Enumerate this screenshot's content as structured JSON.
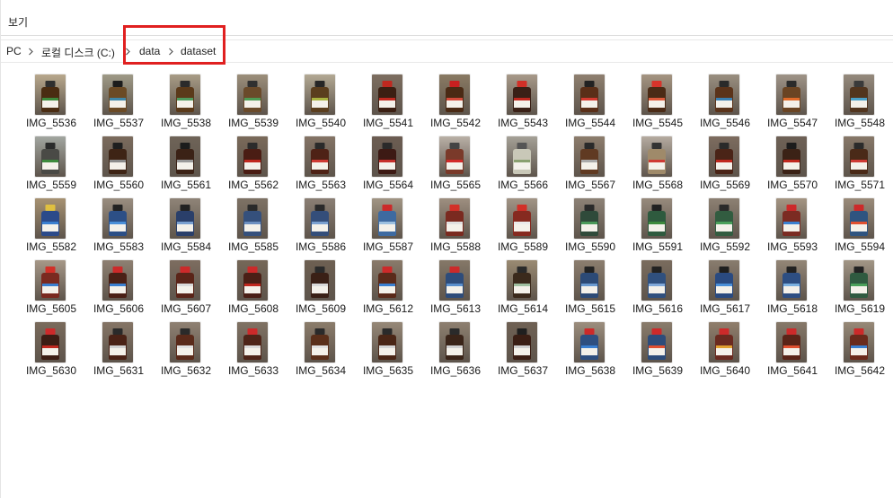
{
  "menu": {
    "view_label": "보기"
  },
  "breadcrumb": {
    "pc": "PC",
    "drive": "로컬 디스크 (C:)",
    "folder1": "data",
    "folder2": "dataset"
  },
  "files": [
    {
      "name": "IMG_5536",
      "bg": "#b8a88d",
      "bottle": "#4a2c12",
      "cap": "#2f2f2f",
      "mark": "#3d8a3d"
    },
    {
      "name": "IMG_5537",
      "bg": "#9f9a87",
      "bottle": "#6b4a25",
      "cap": "#1c1c1c",
      "mark": "#3f86a8"
    },
    {
      "name": "IMG_5538",
      "bg": "#a89c86",
      "bottle": "#5b3a1a",
      "cap": "#2b2b2b",
      "mark": "#4f9a5d"
    },
    {
      "name": "IMG_5539",
      "bg": "#9c8f7b",
      "bottle": "#6a4a2a",
      "cap": "#303030",
      "mark": "#4d9b55"
    },
    {
      "name": "IMG_5540",
      "bg": "#b3a994",
      "bottle": "#5b3e1e",
      "cap": "#262626",
      "mark": "#a8b240"
    },
    {
      "name": "IMG_5541",
      "bg": "#7d6e60",
      "bottle": "#3b1f12",
      "cap": "#c0281f",
      "mark": "#c0281f"
    },
    {
      "name": "IMG_5542",
      "bg": "#8a7a63",
      "bottle": "#4a2a14",
      "cap": "#c82020",
      "mark": "#d24a3a"
    },
    {
      "name": "IMG_5543",
      "bg": "#a89a8a",
      "bottle": "#3a2016",
      "cap": "#d23028",
      "mark": "#c0281f"
    },
    {
      "name": "IMG_5544",
      "bg": "#8f8070",
      "bottle": "#5a2f18",
      "cap": "#222",
      "mark": "#d43a30"
    },
    {
      "name": "IMG_5545",
      "bg": "#a59582",
      "bottle": "#4b2b16",
      "cap": "#d7342b",
      "mark": "#dd5a3b"
    },
    {
      "name": "IMG_5546",
      "bg": "#9a8f80",
      "bottle": "#5b331a",
      "cap": "#2a2a2a",
      "mark": "#3a7fb0"
    },
    {
      "name": "IMG_5547",
      "bg": "#9f9488",
      "bottle": "#6a4423",
      "cap": "#2b2b2b",
      "mark": "#e06a2a"
    },
    {
      "name": "IMG_5548",
      "bg": "#958a7d",
      "bottle": "#52351e",
      "cap": "#3a3a3a",
      "mark": "#4aa0c8"
    },
    {
      "name": "IMG_5559",
      "bg": "#a2a6a0",
      "bottle": "#4a4a46",
      "cap": "#2b2b2b",
      "mark": "#3d8a3d"
    },
    {
      "name": "IMG_5560",
      "bg": "#7b6b5d",
      "bottle": "#3e2415",
      "cap": "#1f1f1f",
      "mark": "#8b8b8b"
    },
    {
      "name": "IMG_5561",
      "bg": "#6f6458",
      "bottle": "#3b2216",
      "cap": "#1c1c1c",
      "mark": "#999"
    },
    {
      "name": "IMG_5562",
      "bg": "#7a6a5a",
      "bottle": "#4a1d14",
      "cap": "#2b2b2b",
      "mark": "#c0281f"
    },
    {
      "name": "IMG_5563",
      "bg": "#847466",
      "bottle": "#4e2216",
      "cap": "#2a2a2a",
      "mark": "#cf3a34"
    },
    {
      "name": "IMG_5564",
      "bg": "#6c5d52",
      "bottle": "#3d1a14",
      "cap": "#2a2a2a",
      "mark": "#c62f2a"
    },
    {
      "name": "IMG_5565",
      "bg": "#b9b0a6",
      "bottle": "#7a3a2a",
      "cap": "#444",
      "mark": "#d22a2a"
    },
    {
      "name": "IMG_5566",
      "bg": "#a5a197",
      "bottle": "#c9c8b8",
      "cap": "#555",
      "mark": "#8aa070"
    },
    {
      "name": "IMG_5567",
      "bg": "#8d7d6d",
      "bottle": "#603a22",
      "cap": "#2a2a2a",
      "mark": "#aaa"
    },
    {
      "name": "IMG_5568",
      "bg": "#b5aba0",
      "bottle": "#9f8a6a",
      "cap": "#333",
      "mark": "#cf3a34"
    },
    {
      "name": "IMG_5569",
      "bg": "#7d6c5f",
      "bottle": "#4a2417",
      "cap": "#2a2a2a",
      "mark": "#c0281f"
    },
    {
      "name": "IMG_5570",
      "bg": "#6e6156",
      "bottle": "#3b2216",
      "cap": "#1c1c1c",
      "mark": "#c0281f"
    },
    {
      "name": "IMG_5571",
      "bg": "#877869",
      "bottle": "#4a2a18",
      "cap": "#2b2b2b",
      "mark": "#cf3a34"
    },
    {
      "name": "IMG_5582",
      "bg": "#a79272",
      "bottle": "#2b4a8a",
      "cap": "#e0c040",
      "mark": "#3a7fd0"
    },
    {
      "name": "IMG_5583",
      "bg": "#9a8e80",
      "bottle": "#2c4f86",
      "cap": "#222",
      "mark": "#4a8fd8"
    },
    {
      "name": "IMG_5584",
      "bg": "#8f8478",
      "bottle": "#2a3f6a",
      "cap": "#222",
      "mark": "#7aa0d0"
    },
    {
      "name": "IMG_5585",
      "bg": "#7e7265",
      "bottle": "#35507c",
      "cap": "#2a2a2a",
      "mark": "#6c8fc0"
    },
    {
      "name": "IMG_5586",
      "bg": "#8b7f74",
      "bottle": "#344e7a",
      "cap": "#2a2a2a",
      "mark": "#7aa0d0"
    },
    {
      "name": "IMG_5587",
      "bg": "#a19584",
      "bottle": "#3e6aa0",
      "cap": "#cc2a2a",
      "mark": "#9cc0e0"
    },
    {
      "name": "IMG_5588",
      "bg": "#9e8f80",
      "bottle": "#7a2a20",
      "cap": "#d23028",
      "mark": "#e0e0e0"
    },
    {
      "name": "IMG_5589",
      "bg": "#a29586",
      "bottle": "#862a20",
      "cap": "#d23028",
      "mark": "#eaeaea"
    },
    {
      "name": "IMG_5590",
      "bg": "#8d8276",
      "bottle": "#2f4a3a",
      "cap": "#2a2a2a",
      "mark": "#4a9a5a"
    },
    {
      "name": "IMG_5591",
      "bg": "#978a7c",
      "bottle": "#2e5a3e",
      "cap": "#222",
      "mark": "#3d8a3d"
    },
    {
      "name": "IMG_5592",
      "bg": "#8d8173",
      "bottle": "#325c40",
      "cap": "#2a2a2a",
      "mark": "#4aa05a"
    },
    {
      "name": "IMG_5593",
      "bg": "#a49583",
      "bottle": "#7b2b22",
      "cap": "#cc2a2a",
      "mark": "#3a7fd0"
    },
    {
      "name": "IMG_5594",
      "bg": "#9a8b7a",
      "bottle": "#2f5480",
      "cap": "#cc2a2a",
      "mark": "#e05030"
    },
    {
      "name": "IMG_5605",
      "bg": "#a69888",
      "bottle": "#7a2a20",
      "cap": "#d23028",
      "mark": "#3a7fd0"
    },
    {
      "name": "IMG_5606",
      "bg": "#8e8072",
      "bottle": "#4a2016",
      "cap": "#cc2a2a",
      "mark": "#3a7fd0"
    },
    {
      "name": "IMG_5607",
      "bg": "#7d6d60",
      "bottle": "#5a2418",
      "cap": "#cc2a2a",
      "mark": "#d9d9d9"
    },
    {
      "name": "IMG_5608",
      "bg": "#756758",
      "bottle": "#4a1f16",
      "cap": "#cc2a2a",
      "mark": "#c0281f"
    },
    {
      "name": "IMG_5609",
      "bg": "#6e6052",
      "bottle": "#3a2016",
      "cap": "#2a2a2a",
      "mark": "#d9d9d9"
    },
    {
      "name": "IMG_5612",
      "bg": "#8a7a6a",
      "bottle": "#5a2a1a",
      "cap": "#cc2a2a",
      "mark": "#3a7fd0"
    },
    {
      "name": "IMG_5613",
      "bg": "#857868",
      "bottle": "#2e4c7a",
      "cap": "#cc2a2a",
      "mark": "#5a8fcc"
    },
    {
      "name": "IMG_5614",
      "bg": "#9a8a72",
      "bottle": "#3b2a1c",
      "cap": "#2a2a2a",
      "mark": "#a0c0a0"
    },
    {
      "name": "IMG_5615",
      "bg": "#8c7e6f",
      "bottle": "#2c4a76",
      "cap": "#222",
      "mark": "#6a9ad0"
    },
    {
      "name": "IMG_5616",
      "bg": "#7a6c5e",
      "bottle": "#30507e",
      "cap": "#222",
      "mark": "#80a8d8"
    },
    {
      "name": "IMG_5617",
      "bg": "#897c6e",
      "bottle": "#2a4a80",
      "cap": "#1f1f1f",
      "mark": "#4a8fd8"
    },
    {
      "name": "IMG_5618",
      "bg": "#938677",
      "bottle": "#2d4e82",
      "cap": "#222",
      "mark": "#7ab0e0"
    },
    {
      "name": "IMG_5619",
      "bg": "#a29686",
      "bottle": "#2f5a40",
      "cap": "#222",
      "mark": "#4aa05a"
    },
    {
      "name": "IMG_5630",
      "bg": "#7a6b5c",
      "bottle": "#3c1d14",
      "cap": "#cc2a2a",
      "mark": "#c0281f"
    },
    {
      "name": "IMG_5631",
      "bg": "#857566",
      "bottle": "#4a2216",
      "cap": "#2a2a2a",
      "mark": "#d0d0d0"
    },
    {
      "name": "IMG_5632",
      "bg": "#8f8172",
      "bottle": "#5a2a1a",
      "cap": "#2a2a2a",
      "mark": "#e0e0e0"
    },
    {
      "name": "IMG_5633",
      "bg": "#807264",
      "bottle": "#4e2418",
      "cap": "#cc2a2a",
      "mark": "#d9d9d9"
    },
    {
      "name": "IMG_5634",
      "bg": "#8b7c6b",
      "bottle": "#5a2f1a",
      "cap": "#2a2a2a",
      "mark": "#e0e0e0"
    },
    {
      "name": "IMG_5635",
      "bg": "#968878",
      "bottle": "#4a2616",
      "cap": "#2a2a2a",
      "mark": "#d4d4d4"
    },
    {
      "name": "IMG_5636",
      "bg": "#8e8070",
      "bottle": "#3a2418",
      "cap": "#2a2a2a",
      "mark": "#cfcfcf"
    },
    {
      "name": "IMG_5637",
      "bg": "#6f6154",
      "bottle": "#3a1e14",
      "cap": "#1f1f1f",
      "mark": "#cfcfcf"
    },
    {
      "name": "IMG_5638",
      "bg": "#9c8e7e",
      "bottle": "#2e4f80",
      "cap": "#cc2a2a",
      "mark": "#3a7fd0"
    },
    {
      "name": "IMG_5639",
      "bg": "#8a7c6c",
      "bottle": "#2d4c7a",
      "cap": "#cc2a2a",
      "mark": "#e05030"
    },
    {
      "name": "IMG_5640",
      "bg": "#907e6c",
      "bottle": "#6a2a20",
      "cap": "#cc2a2a",
      "mark": "#e0a030"
    },
    {
      "name": "IMG_5641",
      "bg": "#867869",
      "bottle": "#5a2418",
      "cap": "#cc2a2a",
      "mark": "#e05030"
    },
    {
      "name": "IMG_5642",
      "bg": "#978978",
      "bottle": "#6a2a1c",
      "cap": "#cc2a2a",
      "mark": "#3a7fd0"
    }
  ]
}
